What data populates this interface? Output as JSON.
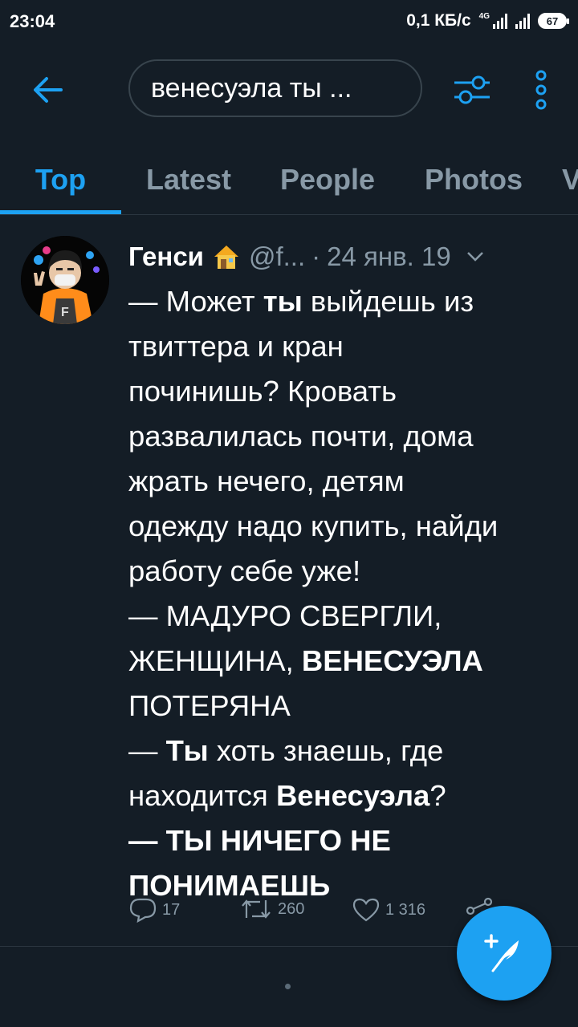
{
  "status_bar": {
    "time": "23:04",
    "speed": "0,1 КБ/с",
    "network": "4G",
    "battery": "67"
  },
  "search": {
    "query": "венесуэла ты ..."
  },
  "tabs": [
    {
      "label": "Top",
      "active": true
    },
    {
      "label": "Latest",
      "active": false
    },
    {
      "label": "People",
      "active": false
    },
    {
      "label": "Photos",
      "active": false
    },
    {
      "label": "V",
      "active": false
    }
  ],
  "tweet": {
    "author": "Генси",
    "handle": "@f...",
    "separator": "·",
    "date": "24 янв. 19",
    "lines": [
      [
        {
          "t": "— Может "
        },
        {
          "t": "ты",
          "b": true
        },
        {
          "t": " выйдешь из"
        }
      ],
      [
        {
          "t": "твиттера и кран"
        }
      ],
      [
        {
          "t": "починишь? Кровать"
        }
      ],
      [
        {
          "t": "развалилась почти, дома"
        }
      ],
      [
        {
          "t": "жрать нечего, детям"
        }
      ],
      [
        {
          "t": "одежду надо купить, найди"
        }
      ],
      [
        {
          "t": "работу себе уже!"
        }
      ],
      [
        {
          "t": "— МАДУРО СВЕРГЛИ,"
        }
      ],
      [
        {
          "t": "ЖЕНЩИНА, "
        },
        {
          "t": "ВЕНЕСУЭЛА",
          "b": true
        }
      ],
      [
        {
          "t": "ПОТЕРЯНА"
        }
      ],
      [
        {
          "t": "— "
        },
        {
          "t": "Ты",
          "b": true
        },
        {
          "t": " хоть знаешь, где"
        }
      ],
      [
        {
          "t": "находится "
        },
        {
          "t": "Венесуэла",
          "b": true
        },
        {
          "t": "?"
        }
      ],
      [
        {
          "t": "— ТЫ НИЧЕГО НЕ",
          "b": true
        }
      ],
      [
        {
          "t": "ПОНИМАЕШЬ",
          "b": true
        }
      ]
    ],
    "replies": "17",
    "retweets": "260",
    "likes": "1 316"
  },
  "icons": {
    "back": "arrow-left-icon",
    "filter": "sliders-icon",
    "more": "more-vertical-icon",
    "compose": "feather-plus-icon"
  },
  "colors": {
    "background": "#141d26",
    "accent": "#1da1f2",
    "muted": "#8899a6",
    "divider": "#2b3640"
  }
}
